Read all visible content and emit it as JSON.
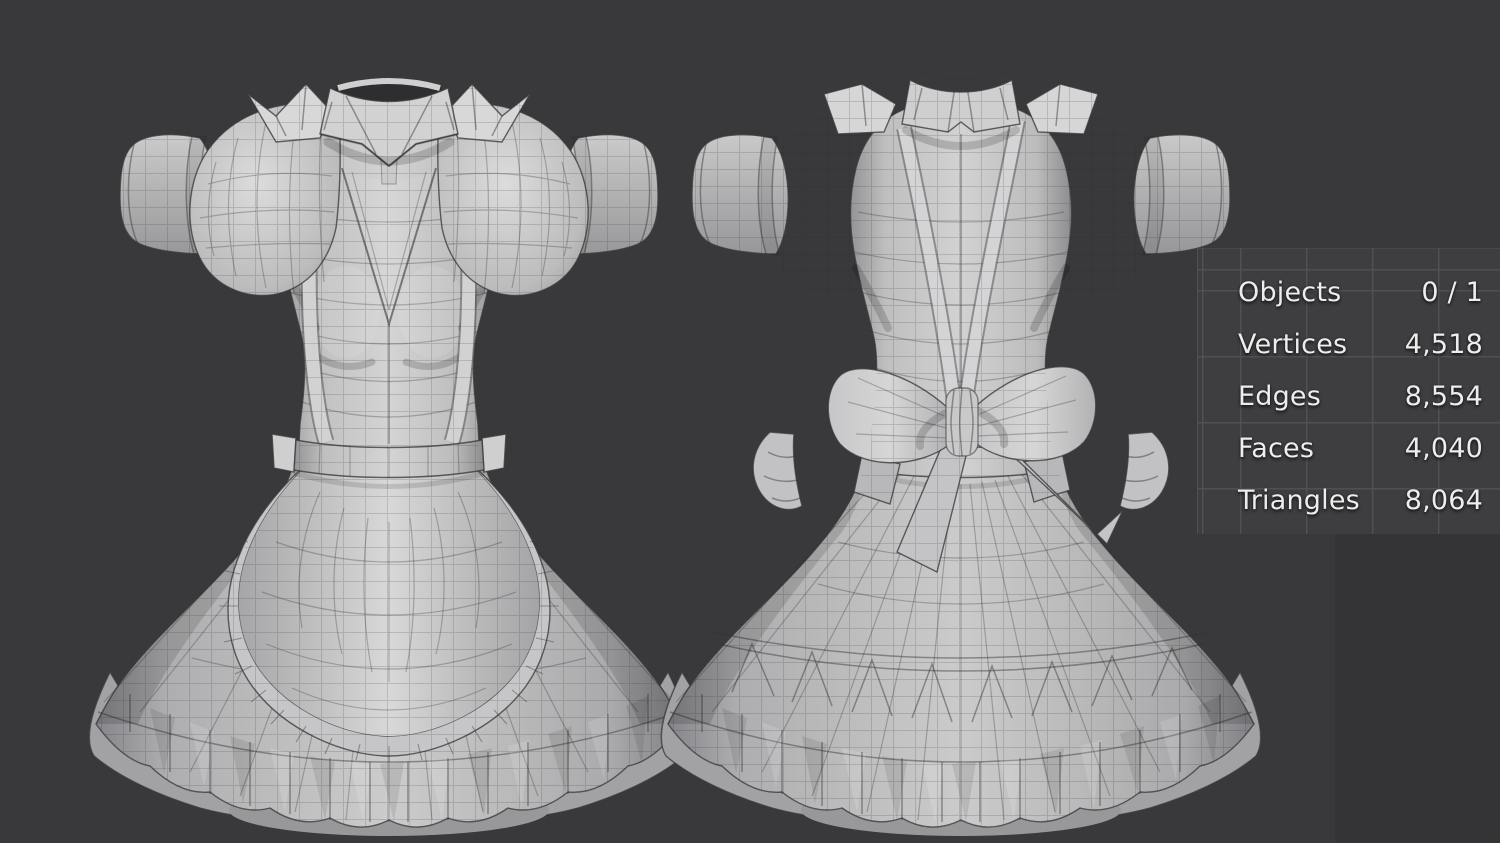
{
  "colors": {
    "bg": "#39393b",
    "bg-shade": "#333335",
    "panel-bg": "#3e3e41",
    "panel-grid": "#505052",
    "stats-text": "#ededed",
    "mesh-light": "#d3d3d3",
    "mesh-mid": "#c0c0c0",
    "mesh-dark": "#8f8f8f",
    "wire": "#5a5a5a"
  },
  "stats_panel": {
    "rows": [
      {
        "label": "Objects",
        "value": "0 / 1"
      },
      {
        "label": "Vertices",
        "value": "4,518"
      },
      {
        "label": "Edges",
        "value": "8,554"
      },
      {
        "label": "Faces",
        "value": "4,040"
      },
      {
        "label": "Triangles",
        "value": "8,064"
      }
    ]
  }
}
